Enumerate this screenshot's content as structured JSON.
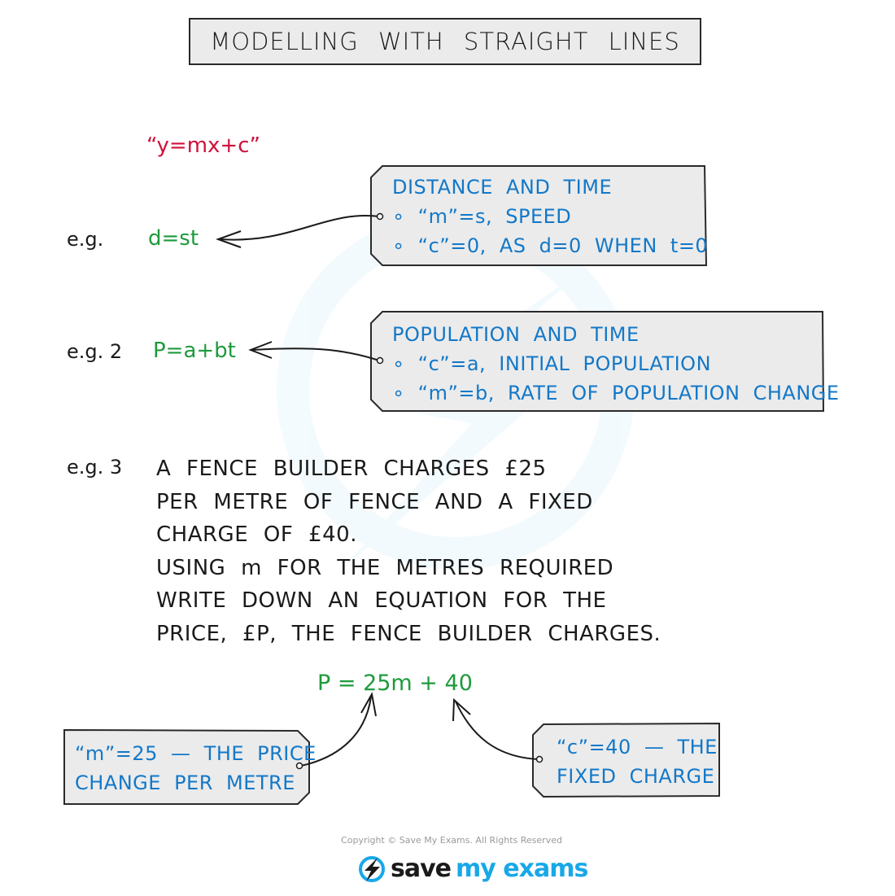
{
  "title": "MODELLING WITH STRAIGHT LINES",
  "general_form": "“y=mx+c”",
  "examples": [
    {
      "label": "e.g.",
      "equation": "d=st",
      "box": {
        "heading": "DISTANCE AND TIME",
        "bullets": [
          "“m”=s, SPEED",
          "“c”=0, AS d=0 WHEN t=0"
        ]
      }
    },
    {
      "label": "e.g. 2",
      "equation": "P=a+bt",
      "box": {
        "heading": "POPULATION AND TIME",
        "bullets": [
          "“c”=a, INITIAL POPULATION",
          "“m”=b, RATE OF POPULATION CHANGE"
        ]
      }
    },
    {
      "label": "e.g. 3",
      "question_lines": [
        "A FENCE BUILDER CHARGES £25",
        "PER METRE OF FENCE AND A FIXED",
        "CHARGE OF £40.",
        "USING m FOR THE METRES REQUIRED",
        "WRITE DOWN AN EQUATION FOR THE",
        "PRICE, £P, THE FENCE BUILDER CHARGES."
      ],
      "answer": "P = 25m + 40",
      "left_box": [
        "“m”=25 — THE PRICE",
        "CHANGE PER METRE"
      ],
      "right_box": [
        "“c”=40 — THE",
        "FIXED CHARGE"
      ]
    }
  ],
  "footer": {
    "copyright": "Copyright © Save My Exams. All Rights Reserved",
    "logo_save": "save",
    "logo_myexams": "my exams"
  },
  "colors": {
    "red": "#d0103a",
    "green": "#1e9a3c",
    "blue": "#1378c8",
    "box_fill": "#ebebeb",
    "brand_blue": "#18a8e8"
  }
}
